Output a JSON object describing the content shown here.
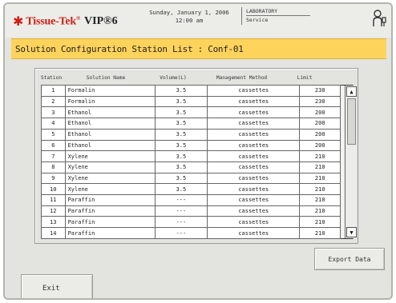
{
  "brand": {
    "name": "Tissue-Tek",
    "mark": "®",
    "model": "VIP®6"
  },
  "status": {
    "date": "Sunday, January 1, 2006",
    "time": "12:00 am",
    "location": "LABORATORY",
    "mode": "Service"
  },
  "icons": {
    "brand_star": "star-logo-icon",
    "user": "user-key-icon",
    "scroll_up": "arrow-up-icon",
    "scroll_down": "arrow-down-icon"
  },
  "banner": {
    "title": "Solution Configuration Station List  : Conf-01"
  },
  "table": {
    "headers": {
      "station": "Station",
      "name": "Solution Name",
      "volume": "Volume(L)",
      "method": "Management Method",
      "limit": "Limit"
    },
    "rows": [
      {
        "station": "1",
        "name": "Formalin",
        "volume": "3.5",
        "method": "cassettes",
        "limit": "230"
      },
      {
        "station": "2",
        "name": "Formalin",
        "volume": "3.5",
        "method": "cassettes",
        "limit": "230"
      },
      {
        "station": "3",
        "name": "Ethanol",
        "volume": "3.5",
        "method": "cassettes",
        "limit": "200"
      },
      {
        "station": "4",
        "name": "Ethanol",
        "volume": "3.5",
        "method": "cassettes",
        "limit": "200"
      },
      {
        "station": "5",
        "name": "Ethanol",
        "volume": "3.5",
        "method": "cassettes",
        "limit": "200"
      },
      {
        "station": "6",
        "name": "Ethanol",
        "volume": "3.5",
        "method": "cassettes",
        "limit": "200"
      },
      {
        "station": "7",
        "name": "Xylene",
        "volume": "3.5",
        "method": "cassettes",
        "limit": "210"
      },
      {
        "station": "8",
        "name": "Xylene",
        "volume": "3.5",
        "method": "cassettes",
        "limit": "210"
      },
      {
        "station": "9",
        "name": "Xylene",
        "volume": "3.5",
        "method": "cassettes",
        "limit": "210"
      },
      {
        "station": "10",
        "name": "Xylene",
        "volume": "3.5",
        "method": "cassettes",
        "limit": "210"
      },
      {
        "station": "11",
        "name": "Paraffin",
        "volume": "---",
        "method": "cassettes",
        "limit": "210"
      },
      {
        "station": "12",
        "name": "Paraffin",
        "volume": "---",
        "method": "cassettes",
        "limit": "210"
      },
      {
        "station": "13",
        "name": "Paraffin",
        "volume": "---",
        "method": "cassettes",
        "limit": "210"
      },
      {
        "station": "14",
        "name": "Paraffin",
        "volume": "---",
        "method": "cassettes",
        "limit": "210"
      }
    ]
  },
  "buttons": {
    "export": "Export Data",
    "exit": "Exit"
  },
  "colors": {
    "banner": "#fed35b",
    "brand_red": "#cc1f16",
    "background": "#e3e3df"
  }
}
